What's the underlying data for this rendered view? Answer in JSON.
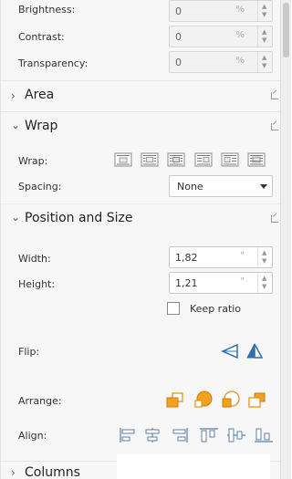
{
  "image": {
    "brightness_label": "Brightness:",
    "brightness_value": "0",
    "contrast_label": "Contrast:",
    "contrast_value": "0",
    "transparency_label": "Transparency:",
    "transparency_value": "0",
    "percent_unit": "%"
  },
  "sections": {
    "area": "Area",
    "wrap": "Wrap",
    "position_size": "Position and Size",
    "columns": "Columns"
  },
  "wrap": {
    "wrap_label": "Wrap:",
    "spacing_label": "Spacing:",
    "spacing_value": "None",
    "options": [
      "wrap-off-icon",
      "wrap-parallel-icon",
      "wrap-optimal-icon",
      "wrap-before-icon",
      "wrap-after-icon",
      "wrap-through-icon"
    ]
  },
  "position": {
    "width_label": "Width:",
    "width_value": "1,82",
    "height_label": "Height:",
    "height_value": "1,21",
    "unit_mark": "\"",
    "keep_ratio_label": "Keep ratio",
    "flip_label": "Flip:",
    "arrange_label": "Arrange:",
    "align_label": "Align:"
  },
  "colors": {
    "accent_blue": "#2f6fb3",
    "accent_orange": "#f2a21b"
  }
}
